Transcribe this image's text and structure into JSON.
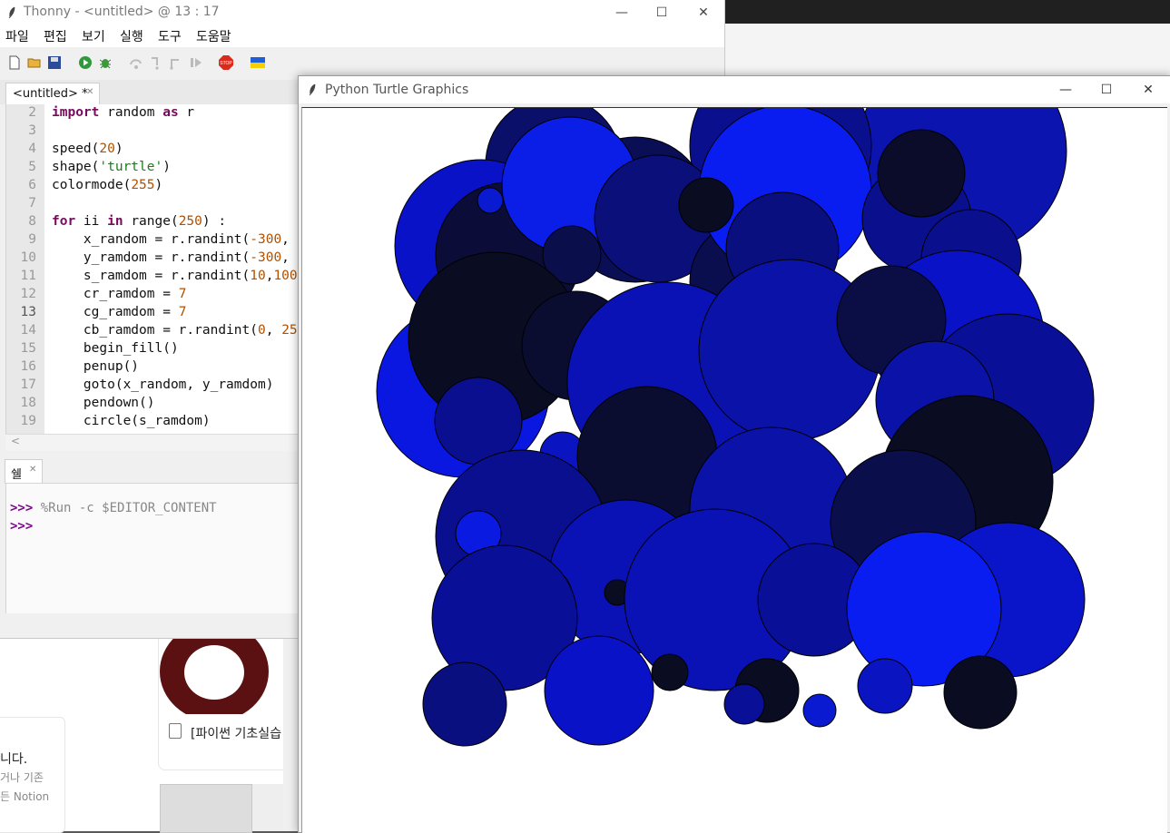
{
  "thonny": {
    "title": "Thonny  -  <untitled>  @  13 : 17",
    "menu": [
      "파일",
      "편집",
      "보기",
      "실행",
      "도구",
      "도움말"
    ],
    "editor_tab": "<untitled> *",
    "code": [
      {
        "n": "2",
        "html": "<span class='kw'>import</span> random <span class='kw'>as</span> r"
      },
      {
        "n": "3",
        "html": ""
      },
      {
        "n": "4",
        "html": "speed(<span class='num'>20</span>)"
      },
      {
        "n": "5",
        "html": "shape(<span class='str'>'turtle'</span>)"
      },
      {
        "n": "6",
        "html": "colormode(<span class='num'>255</span>)"
      },
      {
        "n": "7",
        "html": ""
      },
      {
        "n": "8",
        "html": "<span class='kw'>for</span> ii <span class='kw'>in</span> range(<span class='num'>250</span>) :"
      },
      {
        "n": "9",
        "html": "    x_random = r.randint(<span class='num'>-300</span>,"
      },
      {
        "n": "10",
        "html": "    y_ramdom = r.randint(<span class='num'>-300</span>,"
      },
      {
        "n": "11",
        "html": "    s_ramdom = r.randint(<span class='num'>10</span>,<span class='num'>100</span>"
      },
      {
        "n": "12",
        "html": "    cr_ramdom = <span class='num'>7</span>"
      },
      {
        "n": "13",
        "html": "    cg_ramdom = <span class='num'>7</span>"
      },
      {
        "n": "14",
        "html": "    cb_ramdom = r.randint(<span class='num'>0</span>, <span class='num'>25</span>"
      },
      {
        "n": "15",
        "html": "    begin_fill()"
      },
      {
        "n": "16",
        "html": "    penup()"
      },
      {
        "n": "17",
        "html": "    goto(x_random, y_ramdom)"
      },
      {
        "n": "18",
        "html": "    pendown()"
      },
      {
        "n": "19",
        "html": "    circle(s_ramdom)"
      }
    ],
    "current_line": "13",
    "shell_tab": "쉘",
    "shell": {
      "prompt": ">>>",
      "command": " %Run -c $EDITOR_CONTENT"
    }
  },
  "turtle_window": {
    "title": "Python Turtle Graphics"
  },
  "background_page": {
    "card_title": "[파이썬 기초실습",
    "text1": "니다.",
    "text2": "거나 기존",
    "text3": "든 Notion"
  },
  "colors": {
    "accent_blue": "#0a1df0",
    "dark_navy": "#0a0c22",
    "stop_red": "#d92a1c"
  }
}
